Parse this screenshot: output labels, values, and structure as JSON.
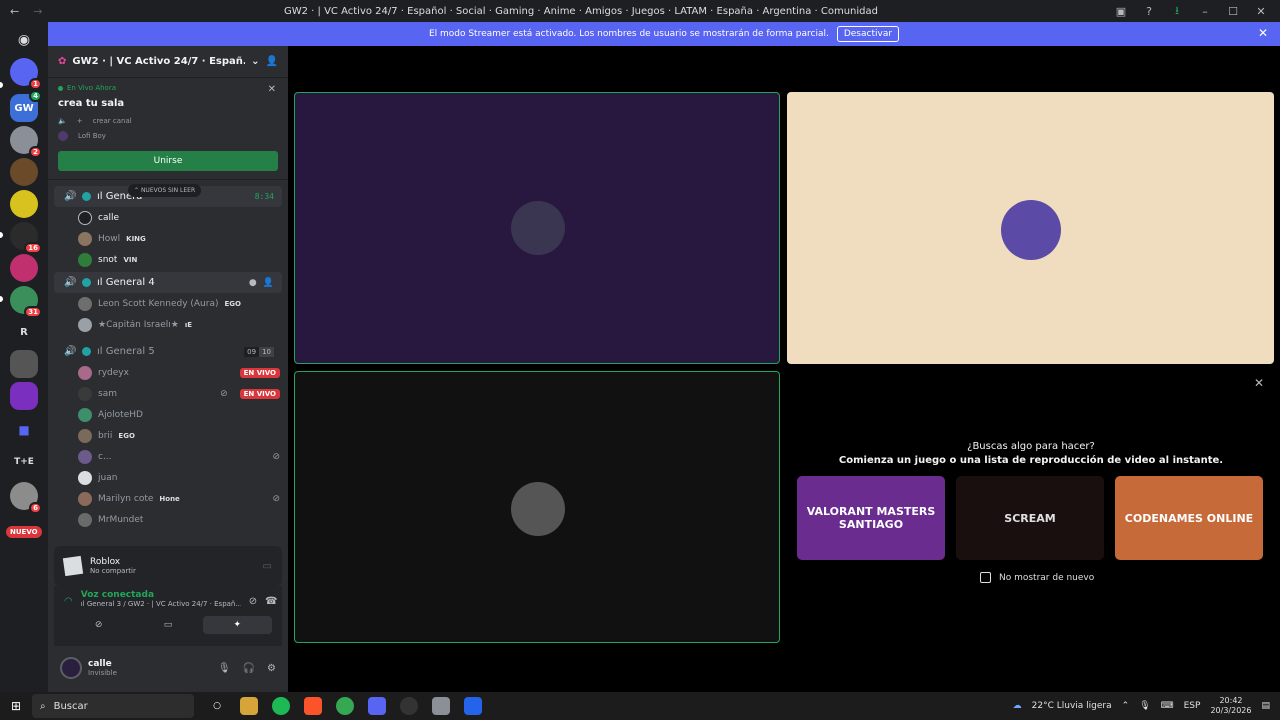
{
  "titlebar": {
    "title": "GW2 · | VC Activo 24/7 · Español · Social · Gaming · Anime · Amigos · Juegos · LATAM · España · Argentina · Comunidad"
  },
  "banner": {
    "text": "El modo Streamer está activado. Los nombres de usuario se mostrarán de forma parcial.",
    "button": "Desactivar"
  },
  "rail": {
    "badges": [
      "1",
      "4",
      "2",
      "16",
      "31",
      "6"
    ],
    "new_label": "NUEVO",
    "letters": [
      "R",
      "T+E"
    ]
  },
  "server": {
    "name": "GW2 · | VC Activo 24/7 · Españ..."
  },
  "live_card": {
    "label": "En Vivo Ahora",
    "title": "crea tu sala",
    "create_channel": "crear canal",
    "host": "Lofi Boy",
    "join": "Unirse"
  },
  "new_unread": "NUEVOS SIN LEER",
  "channels": [
    {
      "name": "ıl Genera",
      "timer": "8:34",
      "users": [
        {
          "name": "calle",
          "tag": "",
          "bright": true
        },
        {
          "name": "Howl",
          "tag": "KING"
        },
        {
          "name": "snot",
          "tag": "VIN",
          "bright": true
        }
      ]
    },
    {
      "name": "ıl General 4",
      "users": [
        {
          "name": "Leon Scott Kennedy (Aura)",
          "tag": "EGO"
        },
        {
          "name": "★Capitán Israelı★",
          "tag": "ıE"
        }
      ]
    },
    {
      "name": "ıl General 5",
      "count": [
        "09",
        "10"
      ],
      "users": [
        {
          "name": "rydeyx",
          "live": "EN VIVO"
        },
        {
          "name": "sam",
          "live": "EN VIVO"
        },
        {
          "name": "AjoloteHD"
        },
        {
          "name": "brii",
          "tag": "EGO"
        },
        {
          "name": "c..."
        },
        {
          "name": "juan"
        },
        {
          "name": "Marilyn cote",
          "tag": "Hone"
        },
        {
          "name": "MrMundet"
        }
      ]
    }
  ],
  "activity": {
    "title": "Roblox",
    "subtitle": "No compartir"
  },
  "voice": {
    "status": "Voz conectada",
    "channel": "ıl General 3 / GW2 · | VC Activo 24/7 · Españ..."
  },
  "user": {
    "name": "calle",
    "status": "Invisible"
  },
  "promo": {
    "question": "¿Buscas algo para hacer?",
    "subtitle": "Comienza un juego o una lista de reproducción de video al instante.",
    "cards": [
      "VALORANT MASTERS SANTIAGO",
      "SCREAM",
      "CODENAMES ONLINE"
    ],
    "dont_show": "No mostrar de nuevo"
  },
  "taskbar": {
    "search": "Buscar",
    "weather": "22°C  Lluvia ligera",
    "lang": "ESP",
    "time": "20:42",
    "date": "20/3/2026"
  },
  "colors": {
    "blurple": "#5865f2",
    "green": "#23a55a",
    "red": "#da373c"
  }
}
